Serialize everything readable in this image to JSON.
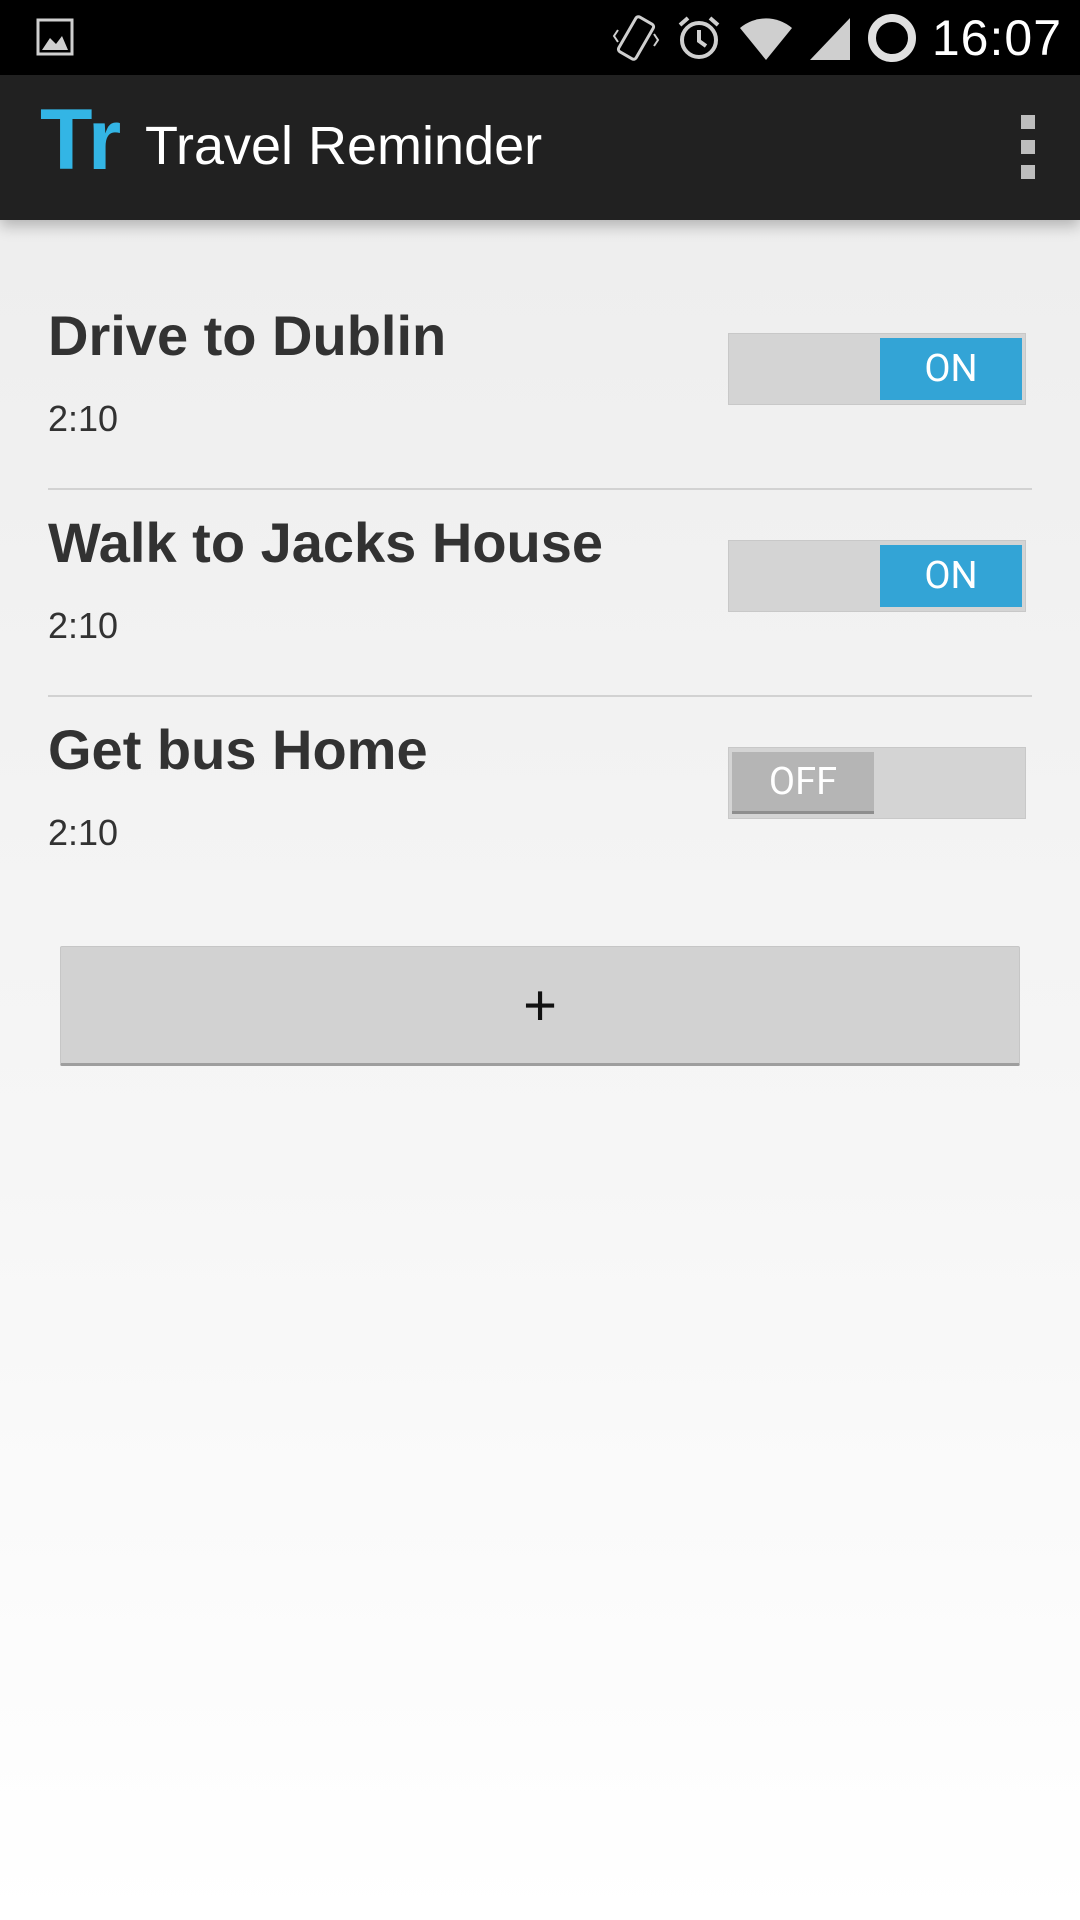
{
  "status_bar": {
    "time": "16:07",
    "icons": [
      "image-icon",
      "vibrate-icon",
      "alarm-icon",
      "wifi-icon",
      "signal-icon",
      "sync-ring-icon"
    ]
  },
  "action_bar": {
    "logo_text": "Tr",
    "title": "Travel Reminder",
    "overflow_icon": "overflow-menu-icon"
  },
  "reminders": [
    {
      "title": "Drive to Dublin",
      "time": "2:10",
      "switch_label": "ON",
      "enabled": true
    },
    {
      "title": "Walk to Jacks House",
      "time": "2:10",
      "switch_label": "ON",
      "enabled": true
    },
    {
      "title": "Get bus Home",
      "time": "2:10",
      "switch_label": "OFF",
      "enabled": false
    }
  ],
  "add_button_label": "+",
  "colors": {
    "accent": "#33b5e5",
    "switch_on": "#33a4d6",
    "action_bar": "#212121",
    "status_bar": "#000000"
  }
}
